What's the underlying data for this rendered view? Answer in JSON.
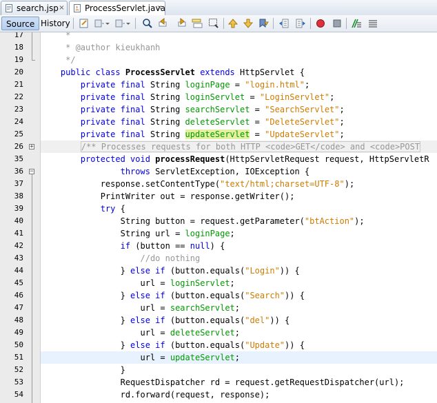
{
  "tabs": [
    {
      "label": "search.jsp",
      "close": "×",
      "icon": "jsp-file-icon",
      "active": false
    },
    {
      "label": "ProcessServlet.java",
      "close": "×",
      "icon": "java-file-icon",
      "active": true
    }
  ],
  "toolbar": {
    "source_label": "Source",
    "history_label": "History",
    "icons": [
      "last-edit-icon",
      "back-icon",
      "forward-icon",
      "find-icon",
      "find-previous-icon",
      "find-next-icon",
      "toggle-highlight-icon",
      "find-selection-icon",
      "previous-bookmark-icon",
      "next-bookmark-icon",
      "toggle-bookmark-icon",
      "shift-left-icon",
      "shift-right-icon",
      "start-macro-icon",
      "stop-macro-icon",
      "comment-icon",
      "uncomment-icon"
    ]
  },
  "editor": {
    "current_line": "51",
    "lines": [
      {
        "n": "17",
        "segs": [
          {
            "t": "     *",
            "c": "cmt"
          }
        ]
      },
      {
        "n": "18",
        "segs": [
          {
            "t": "     * @author kieukhanh",
            "c": "cmt"
          }
        ]
      },
      {
        "n": "19",
        "segs": [
          {
            "t": "     */",
            "c": "cmt"
          }
        ]
      },
      {
        "n": "20",
        "segs": [
          {
            "t": "    ",
            "c": ""
          },
          {
            "t": "public class ",
            "c": "kw"
          },
          {
            "t": "ProcessServlet",
            "c": "bold"
          },
          {
            "t": " extends ",
            "c": "kw"
          },
          {
            "t": "HttpServlet {",
            "c": ""
          }
        ]
      },
      {
        "n": "21",
        "segs": [
          {
            "t": "        ",
            "c": ""
          },
          {
            "t": "private final ",
            "c": "kw"
          },
          {
            "t": "String ",
            "c": ""
          },
          {
            "t": "loginPage",
            "c": "fld"
          },
          {
            "t": " = ",
            "c": ""
          },
          {
            "t": "\"login.html\"",
            "c": "str"
          },
          {
            "t": ";",
            "c": ""
          }
        ]
      },
      {
        "n": "22",
        "segs": [
          {
            "t": "        ",
            "c": ""
          },
          {
            "t": "private final ",
            "c": "kw"
          },
          {
            "t": "String ",
            "c": ""
          },
          {
            "t": "loginServlet",
            "c": "fld"
          },
          {
            "t": " = ",
            "c": ""
          },
          {
            "t": "\"LoginServlet\"",
            "c": "str"
          },
          {
            "t": ";",
            "c": ""
          }
        ]
      },
      {
        "n": "23",
        "segs": [
          {
            "t": "        ",
            "c": ""
          },
          {
            "t": "private final ",
            "c": "kw"
          },
          {
            "t": "String ",
            "c": ""
          },
          {
            "t": "searchServlet",
            "c": "fld"
          },
          {
            "t": " = ",
            "c": ""
          },
          {
            "t": "\"SearchServlet\"",
            "c": "str"
          },
          {
            "t": ";",
            "c": ""
          }
        ]
      },
      {
        "n": "24",
        "segs": [
          {
            "t": "        ",
            "c": ""
          },
          {
            "t": "private final ",
            "c": "kw"
          },
          {
            "t": "String ",
            "c": ""
          },
          {
            "t": "deleteServlet",
            "c": "fld"
          },
          {
            "t": " = ",
            "c": ""
          },
          {
            "t": "\"DeleteServlet\"",
            "c": "str"
          },
          {
            "t": ";",
            "c": ""
          }
        ]
      },
      {
        "n": "25",
        "segs": [
          {
            "t": "        ",
            "c": ""
          },
          {
            "t": "private final ",
            "c": "kw"
          },
          {
            "t": "String ",
            "c": ""
          },
          {
            "t": "updateServlet",
            "c": "fld hl"
          },
          {
            "t": " = ",
            "c": ""
          },
          {
            "t": "\"UpdateServlet\"",
            "c": "str"
          },
          {
            "t": ";",
            "c": ""
          }
        ]
      },
      {
        "n": "26",
        "segs": [
          {
            "t": "        ",
            "c": ""
          },
          {
            "t": "/** Processes requests for both HTTP <code>GET</code> and <code>POST",
            "c": "cmt fold-frame"
          }
        ]
      },
      {
        "n": "35",
        "segs": [
          {
            "t": "        ",
            "c": ""
          },
          {
            "t": "protected void ",
            "c": "kw"
          },
          {
            "t": "processRequest",
            "c": "bold"
          },
          {
            "t": "(HttpServletRequest request, HttpServletR",
            "c": ""
          }
        ]
      },
      {
        "n": "36",
        "segs": [
          {
            "t": "                ",
            "c": ""
          },
          {
            "t": "throws ",
            "c": "kw"
          },
          {
            "t": "ServletException, IOException {",
            "c": ""
          }
        ]
      },
      {
        "n": "37",
        "segs": [
          {
            "t": "            response.setContentType(",
            "c": ""
          },
          {
            "t": "\"text/html;charset=UTF-8\"",
            "c": "str"
          },
          {
            "t": ");",
            "c": ""
          }
        ]
      },
      {
        "n": "38",
        "segs": [
          {
            "t": "            PrintWriter out = response.getWriter();",
            "c": ""
          }
        ]
      },
      {
        "n": "39",
        "segs": [
          {
            "t": "            ",
            "c": ""
          },
          {
            "t": "try ",
            "c": "kw"
          },
          {
            "t": "{",
            "c": ""
          }
        ]
      },
      {
        "n": "40",
        "segs": [
          {
            "t": "                String button = request.getParameter(",
            "c": ""
          },
          {
            "t": "\"btAction\"",
            "c": "str"
          },
          {
            "t": ");",
            "c": ""
          }
        ]
      },
      {
        "n": "41",
        "segs": [
          {
            "t": "                String url = ",
            "c": ""
          },
          {
            "t": "loginPage",
            "c": "fld"
          },
          {
            "t": ";",
            "c": ""
          }
        ]
      },
      {
        "n": "42",
        "segs": [
          {
            "t": "                ",
            "c": ""
          },
          {
            "t": "if ",
            "c": "kw"
          },
          {
            "t": "(button == ",
            "c": ""
          },
          {
            "t": "null",
            "c": "kw"
          },
          {
            "t": ") {",
            "c": ""
          }
        ]
      },
      {
        "n": "43",
        "segs": [
          {
            "t": "                    ",
            "c": ""
          },
          {
            "t": "//do nothing",
            "c": "cmt"
          }
        ]
      },
      {
        "n": "44",
        "segs": [
          {
            "t": "                } ",
            "c": ""
          },
          {
            "t": "else if ",
            "c": "kw"
          },
          {
            "t": "(button.equals(",
            "c": ""
          },
          {
            "t": "\"Login\"",
            "c": "str"
          },
          {
            "t": ")) {",
            "c": ""
          }
        ]
      },
      {
        "n": "45",
        "segs": [
          {
            "t": "                    url = ",
            "c": ""
          },
          {
            "t": "loginServlet",
            "c": "fld"
          },
          {
            "t": ";",
            "c": ""
          }
        ]
      },
      {
        "n": "46",
        "segs": [
          {
            "t": "                } ",
            "c": ""
          },
          {
            "t": "else if ",
            "c": "kw"
          },
          {
            "t": "(button.equals(",
            "c": ""
          },
          {
            "t": "\"Search\"",
            "c": "str"
          },
          {
            "t": ")) {",
            "c": ""
          }
        ]
      },
      {
        "n": "47",
        "segs": [
          {
            "t": "                    url = ",
            "c": ""
          },
          {
            "t": "searchServlet",
            "c": "fld"
          },
          {
            "t": ";",
            "c": ""
          }
        ]
      },
      {
        "n": "48",
        "segs": [
          {
            "t": "                } ",
            "c": ""
          },
          {
            "t": "else if ",
            "c": "kw"
          },
          {
            "t": "(button.equals(",
            "c": ""
          },
          {
            "t": "\"del\"",
            "c": "str"
          },
          {
            "t": ")) {",
            "c": ""
          }
        ]
      },
      {
        "n": "49",
        "segs": [
          {
            "t": "                    url = ",
            "c": ""
          },
          {
            "t": "deleteServlet",
            "c": "fld"
          },
          {
            "t": ";",
            "c": ""
          }
        ]
      },
      {
        "n": "50",
        "segs": [
          {
            "t": "                } ",
            "c": ""
          },
          {
            "t": "else if ",
            "c": "kw"
          },
          {
            "t": "(button.equals(",
            "c": ""
          },
          {
            "t": "\"Update\"",
            "c": "str"
          },
          {
            "t": ")) {",
            "c": ""
          }
        ]
      },
      {
        "n": "51",
        "segs": [
          {
            "t": "                    url = ",
            "c": ""
          },
          {
            "t": "updateServlet",
            "c": "fld"
          },
          {
            "t": ";",
            "c": ""
          }
        ]
      },
      {
        "n": "52",
        "segs": [
          {
            "t": "                }",
            "c": ""
          }
        ]
      },
      {
        "n": "53",
        "segs": [
          {
            "t": "                RequestDispatcher rd = request.getRequestDispatcher(url);",
            "c": ""
          }
        ]
      },
      {
        "n": "54",
        "segs": [
          {
            "t": "                rd.forward(request, response);",
            "c": ""
          }
        ]
      }
    ]
  },
  "colors": {
    "keyword": "#0000e6",
    "string": "#ce7b00",
    "comment": "#969696",
    "field": "#009900",
    "current_line": "#e8f2fe",
    "occurrence_highlight": "#e4f0a0"
  }
}
